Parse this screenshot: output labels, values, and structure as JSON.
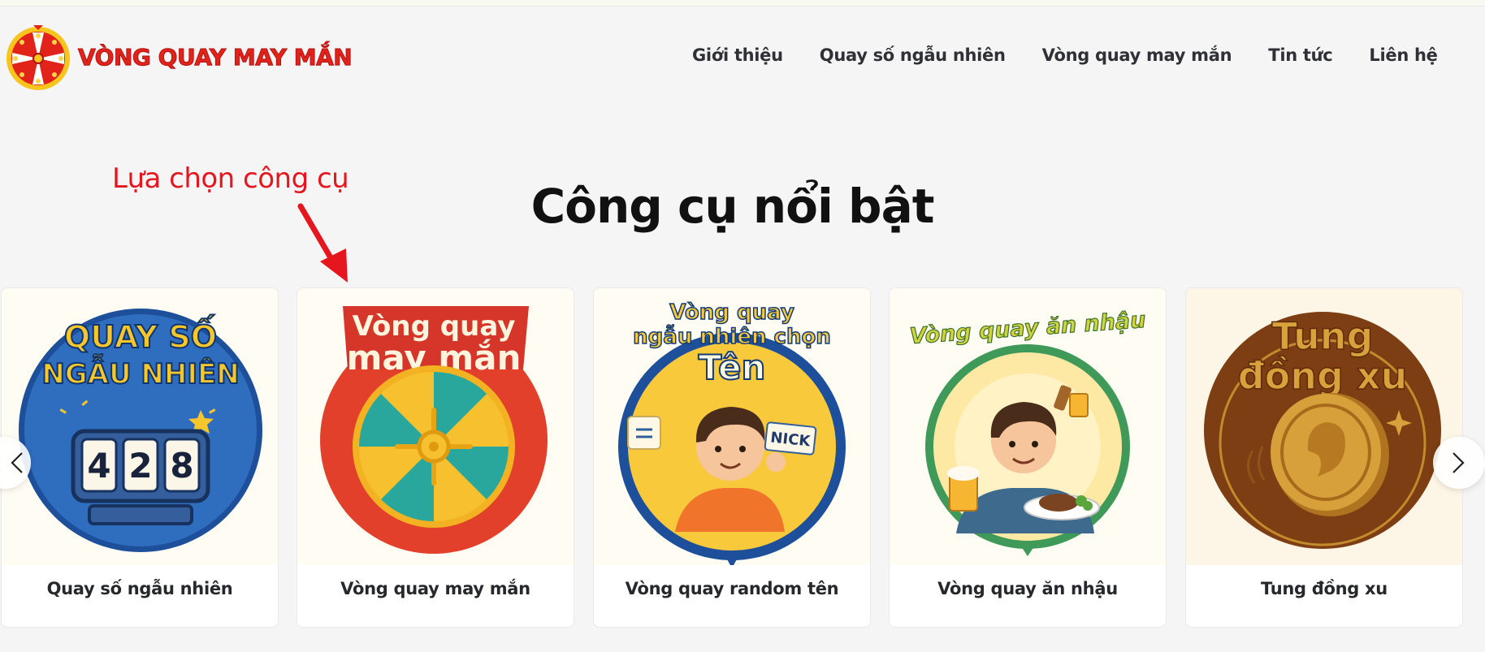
{
  "header": {
    "logo_text": "VÒNG QUAY MAY MẮN",
    "logo_icon": "wheel-logo-icon",
    "nav": [
      {
        "label": "Giới thiệu"
      },
      {
        "label": "Quay số ngẫu nhiên"
      },
      {
        "label": "Vòng quay may mắn"
      },
      {
        "label": "Tin tức"
      },
      {
        "label": "Liên hệ"
      }
    ]
  },
  "annotation": {
    "text": "Lựa chọn công cụ",
    "color": "#e5161d"
  },
  "section": {
    "title": "Công cụ nổi bật"
  },
  "cards": [
    {
      "label": "Quay số ngẫu nhiên",
      "image_text": [
        "QUAY SỐ",
        "NGẪU NHIÊN"
      ],
      "digits": [
        "4",
        "2",
        "8"
      ],
      "icon": "slot-machine-icon"
    },
    {
      "label": "Vòng quay may mắn",
      "image_text": [
        "Vòng quay",
        "may mắn"
      ],
      "icon": "lucky-wheel-icon"
    },
    {
      "label": "Vòng quay random tên",
      "image_text": [
        "Vòng quay",
        "ngẫu nhiên chọn",
        "Tên"
      ],
      "name_tag": "NICK",
      "icon": "boy-name-tag-icon"
    },
    {
      "label": "Vòng quay ăn nhậu",
      "image_text": [
        "Vòng quay ăn nhậu"
      ],
      "icon": "boy-beer-icon"
    },
    {
      "label": "Tung đồng xu",
      "image_text": [
        "Tung",
        "đồng xu"
      ],
      "icon": "coin-icon"
    }
  ],
  "carousel": {
    "prev_icon": "chevron-left-icon",
    "next_icon": "chevron-right-icon"
  },
  "colors": {
    "brand_red": "#e2231a",
    "page_bg": "#f5f5f5"
  }
}
